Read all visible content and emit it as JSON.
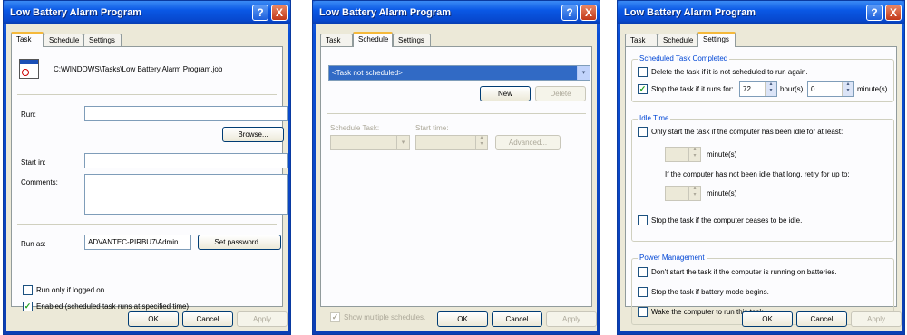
{
  "windows": [
    {
      "title": "Low Battery Alarm Program",
      "tabs": [
        "Task",
        "Schedule",
        "Settings"
      ],
      "active_tab": "Task",
      "task": {
        "job_path": "C:\\WINDOWS\\Tasks\\Low Battery Alarm Program.job",
        "run_label": "Run:",
        "run_value": "",
        "browse_label": "Browse...",
        "start_in_label": "Start in:",
        "start_in_value": "",
        "comments_label": "Comments:",
        "comments_value": "",
        "run_as_label": "Run as:",
        "run_as_value": "ADVANTEC-PIRBU7\\Admin",
        "set_password_label": "Set password...",
        "run_only_logged_label": "Run only if logged on",
        "run_only_logged_checked": false,
        "enabled_label": "Enabled (scheduled task runs at specified time)",
        "enabled_checked": true
      },
      "footer": {
        "ok": "OK",
        "cancel": "Cancel",
        "apply": "Apply"
      }
    },
    {
      "title": "Low Battery Alarm Program",
      "tabs": [
        "Task",
        "Schedule",
        "Settings"
      ],
      "active_tab": "Schedule",
      "schedule": {
        "selected_schedule": "<Task not scheduled>",
        "new_label": "New",
        "delete_label": "Delete",
        "schedule_task_label": "Schedule Task:",
        "start_time_label": "Start time:",
        "advanced_label": "Advanced...",
        "show_multiple_label": "Show multiple schedules.",
        "show_multiple_checked": true
      },
      "footer": {
        "ok": "OK",
        "cancel": "Cancel",
        "apply": "Apply"
      }
    },
    {
      "title": "Low Battery Alarm Program",
      "tabs": [
        "Task",
        "Schedule",
        "Settings"
      ],
      "active_tab": "Settings",
      "settings": {
        "completed_title": "Scheduled Task Completed",
        "delete_if_not_scheduled_label": "Delete the task if it is not scheduled to run again.",
        "delete_if_not_scheduled_checked": false,
        "stop_if_runs_label": "Stop the task if it runs for:",
        "stop_if_runs_checked": true,
        "hours_value": "72",
        "hours_label": "hour(s)",
        "minutes_value": "0",
        "minutes_label": "minute(s).",
        "idle_title": "Idle Time",
        "only_start_idle_label": "Only start the task if the computer has been idle for at least:",
        "only_start_idle_checked": false,
        "idle_minutes_label": "minute(s)",
        "retry_label": "If the computer has not been idle that long, retry for up to:",
        "retry_minutes_label": "minute(s)",
        "stop_if_ceases_idle_label": "Stop the task if the computer ceases to be idle.",
        "stop_if_ceases_idle_checked": false,
        "power_title": "Power Management",
        "dont_start_batteries_label": "Don't start the task if the computer is running on batteries.",
        "dont_start_batteries_checked": false,
        "stop_battery_mode_label": "Stop the task if battery mode begins.",
        "stop_battery_mode_checked": false,
        "wake_label": "Wake the computer to run this task.",
        "wake_checked": false
      },
      "footer": {
        "ok": "OK",
        "cancel": "Cancel",
        "apply": "Apply"
      }
    }
  ],
  "colors": {
    "titlebar": "#0a58e5",
    "dialog_bg": "#ece9d8",
    "group_title": "#0046d5",
    "check_mark": "#21a121",
    "close_button": "#c2391a"
  },
  "icons": {
    "help": "?",
    "close": "X",
    "check": "✓",
    "combo": "▾",
    "spin_up": "▴",
    "spin_down": "▾"
  }
}
